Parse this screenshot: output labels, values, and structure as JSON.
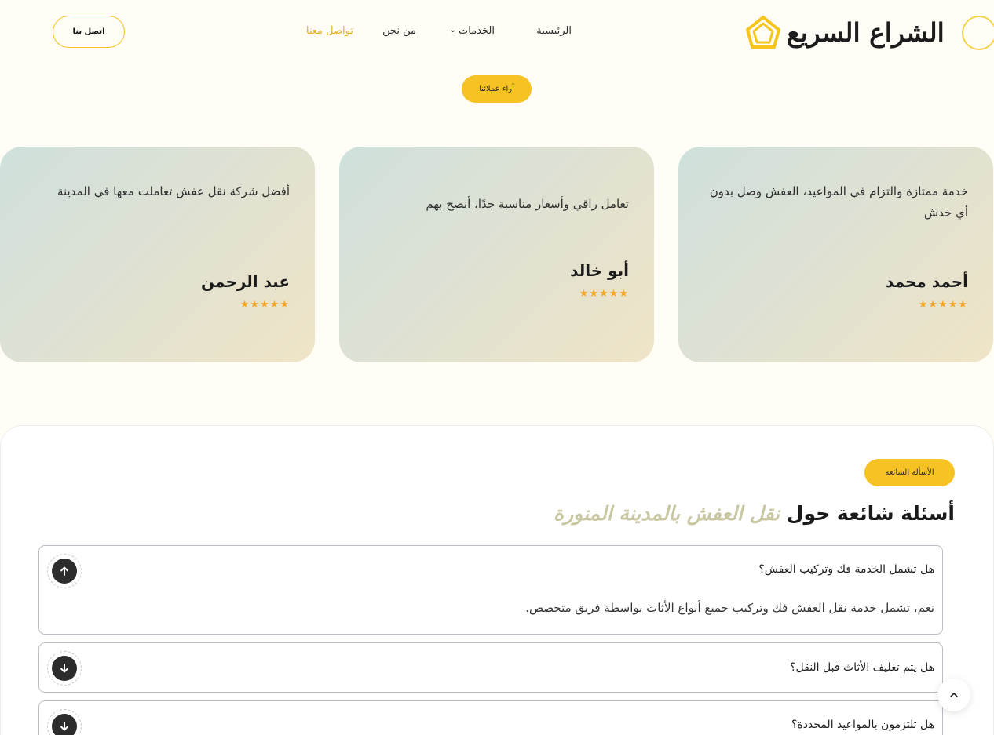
{
  "header": {
    "logo_text": "الشراع السريع",
    "nav": {
      "home": "الرئيسية",
      "services": "الخدمات",
      "about": "من نحن",
      "contact": "تواصل معنا"
    },
    "call_button": "اتصل بنا"
  },
  "testimonials": {
    "section_pill": "آراء عملائنا",
    "cards": [
      {
        "quote": "خدمة ممتازة والتزام في المواعيد، العفش وصل بدون أي خدش",
        "name": "أحمد محمد",
        "stars": "★★★★★"
      },
      {
        "quote": "تعامل راقي وأسعار مناسبة جدًا، أنصح بهم",
        "name": "أبو خالد",
        "stars": "★★★★★"
      },
      {
        "quote": "أفضل شركة نقل عفش تعاملت معها في المدينة",
        "name": "عبد الرحمن",
        "stars": "★★★★★"
      }
    ]
  },
  "faq": {
    "section_pill": "الأسأله الشائعة",
    "title_plain": "أسئلة شائعة حول",
    "title_accent": "نقل العفش بالمدينة المنورة",
    "items": [
      {
        "question": "هل تشمل الخدمة فك وتركيب العفش؟",
        "answer": "نعم، تشمل خدمة نقل العفش فك وتركيب جميع أنواع الأثاث بواسطة فريق متخصص.",
        "state": "expanded"
      },
      {
        "question": "هل يتم تغليف الأثاث قبل النقل؟",
        "state": "collapsed"
      },
      {
        "question": "هل تلتزمون بالمواعيد المحددة؟",
        "state": "collapsed"
      }
    ]
  },
  "colors": {
    "accent_yellow": "#f7c224",
    "accent_olive": "#c8c7a2",
    "star_orange": "#f5a623",
    "page_bg": "#fffdf5"
  },
  "icons": {
    "logo": "house-logo-icon",
    "services_chevron": "chevron-down-icon",
    "faq_open": "arrow-up-circle-icon",
    "faq_closed": "arrow-down-circle-icon",
    "back_to_top": "chevron-up-icon"
  }
}
